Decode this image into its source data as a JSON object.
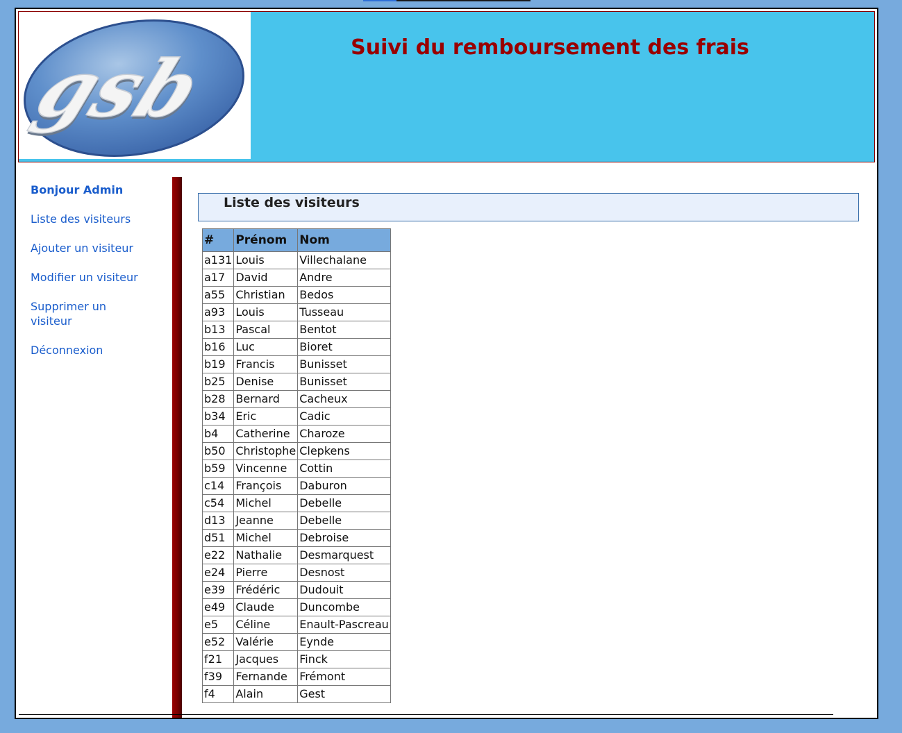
{
  "header": {
    "logo_text": "gsb",
    "title": "Suivi du remboursement des frais"
  },
  "menu": {
    "greeting": "Bonjour Admin",
    "items": [
      {
        "label": "Liste des visiteurs"
      },
      {
        "label": "Ajouter un visiteur"
      },
      {
        "label": "Modifier un visiteur"
      },
      {
        "label": "Supprimer un visiteur"
      },
      {
        "label": "Déconnexion"
      }
    ]
  },
  "main": {
    "section_title": "Liste des visiteurs",
    "table": {
      "headers": [
        "#",
        "Prénom",
        "Nom"
      ],
      "rows": [
        [
          "a131",
          "Louis",
          "Villechalane"
        ],
        [
          "a17",
          "David",
          "Andre"
        ],
        [
          "a55",
          "Christian",
          "Bedos"
        ],
        [
          "a93",
          "Louis",
          "Tusseau"
        ],
        [
          "b13",
          "Pascal",
          "Bentot"
        ],
        [
          "b16",
          "Luc",
          "Bioret"
        ],
        [
          "b19",
          "Francis",
          "Bunisset"
        ],
        [
          "b25",
          "Denise",
          "Bunisset"
        ],
        [
          "b28",
          "Bernard",
          "Cacheux"
        ],
        [
          "b34",
          "Eric",
          "Cadic"
        ],
        [
          "b4",
          "Catherine",
          "Charoze"
        ],
        [
          "b50",
          "Christophe",
          "Clepkens"
        ],
        [
          "b59",
          "Vincenne",
          "Cottin"
        ],
        [
          "c14",
          "François",
          "Daburon"
        ],
        [
          "c54",
          "Michel",
          "Debelle"
        ],
        [
          "d13",
          "Jeanne",
          "Debelle"
        ],
        [
          "d51",
          "Michel",
          "Debroise"
        ],
        [
          "e22",
          "Nathalie",
          "Desmarquest"
        ],
        [
          "e24",
          "Pierre",
          "Desnost"
        ],
        [
          "e39",
          "Frédéric",
          "Dudouit"
        ],
        [
          "e49",
          "Claude",
          "Duncombe"
        ],
        [
          "e5",
          "Céline",
          "Enault-Pascreau"
        ],
        [
          "e52",
          "Valérie",
          "Eynde"
        ],
        [
          "f21",
          "Jacques",
          "Finck"
        ],
        [
          "f39",
          "Fernande",
          "Frémont"
        ],
        [
          "f4",
          "Alain",
          "Gest"
        ]
      ]
    }
  },
  "colors": {
    "page_background": "#77aadd",
    "header_background": "#48c4ec",
    "title_color": "#990000",
    "menu_link": "#1a5dcc",
    "table_header": "#77aadd",
    "sidebar_bar": "#990000"
  }
}
